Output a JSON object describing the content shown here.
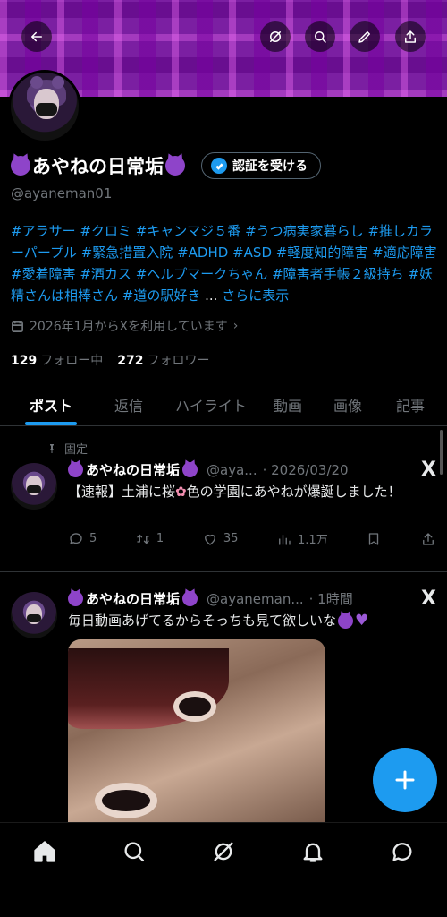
{
  "profile": {
    "display_name": "あやねの日常垢",
    "handle": "@ayaneman01",
    "verify_label": "認証を受ける",
    "bio_parts": [
      {
        "text": "#アラサー",
        "tag": true
      },
      {
        "text": " ",
        "tag": false
      },
      {
        "text": "#クロミ",
        "tag": true
      },
      {
        "text": " ",
        "tag": false
      },
      {
        "text": "#キャンマジ５番",
        "tag": true
      },
      {
        "text": " ",
        "tag": false
      },
      {
        "text": "#うつ病実家暮らし",
        "tag": true
      },
      {
        "text": " ",
        "tag": false
      },
      {
        "text": "#推しカラーパープル",
        "tag": true
      },
      {
        "text": " ",
        "tag": false
      },
      {
        "text": "#緊急措置入院",
        "tag": true
      },
      {
        "text": " ",
        "tag": false
      },
      {
        "text": "#ADHD",
        "tag": true
      },
      {
        "text": " ",
        "tag": false
      },
      {
        "text": "#ASD",
        "tag": true
      },
      {
        "text": " ",
        "tag": false
      },
      {
        "text": "#軽度知的障害",
        "tag": true
      },
      {
        "text": " ",
        "tag": false
      },
      {
        "text": "#適応障害",
        "tag": true
      },
      {
        "text": " ",
        "tag": false
      },
      {
        "text": "#愛着障害",
        "tag": true
      },
      {
        "text": " ",
        "tag": false
      },
      {
        "text": "#酒カス",
        "tag": true
      },
      {
        "text": " ",
        "tag": false
      },
      {
        "text": "#ヘルプマークちゃん",
        "tag": true
      },
      {
        "text": " ",
        "tag": false
      },
      {
        "text": "#障害者手帳２級持ち",
        "tag": true
      },
      {
        "text": " ",
        "tag": false
      },
      {
        "text": "#妖精さんは相棒さん",
        "tag": true
      },
      {
        "text": " ",
        "tag": false
      },
      {
        "text": "#道の駅好き",
        "tag": true
      },
      {
        "text": " ... ",
        "tag": false
      }
    ],
    "show_more": "さらに表示",
    "joined": "2026年1月からXを利用しています",
    "following_count": "129",
    "following_label": "フォロー中",
    "followers_count": "272",
    "followers_label": "フォロワー"
  },
  "tabs": [
    "ポスト",
    "返信",
    "ハイライト",
    "動画",
    "画像",
    "記事"
  ],
  "pinned_label": "固定",
  "posts": [
    {
      "name": "あやねの日常垢",
      "handle": "@aya...",
      "time": "· 2026/03/20",
      "text_before": "【速報】土浦に桜",
      "text_after": "色の学園にあやねが爆誕しました！",
      "replies": "5",
      "reposts": "1",
      "likes": "35",
      "views": "1.1万"
    },
    {
      "name": "あやねの日常垢",
      "handle": "@ayaneman...",
      "time": "· 1時間",
      "text": "毎日動画あげてるからそっちも見て欲しいな"
    }
  ],
  "x_logo": "X",
  "colors": {
    "accent": "#1d9bf0",
    "muted": "#71767b",
    "banner": "#7b1fa2"
  }
}
